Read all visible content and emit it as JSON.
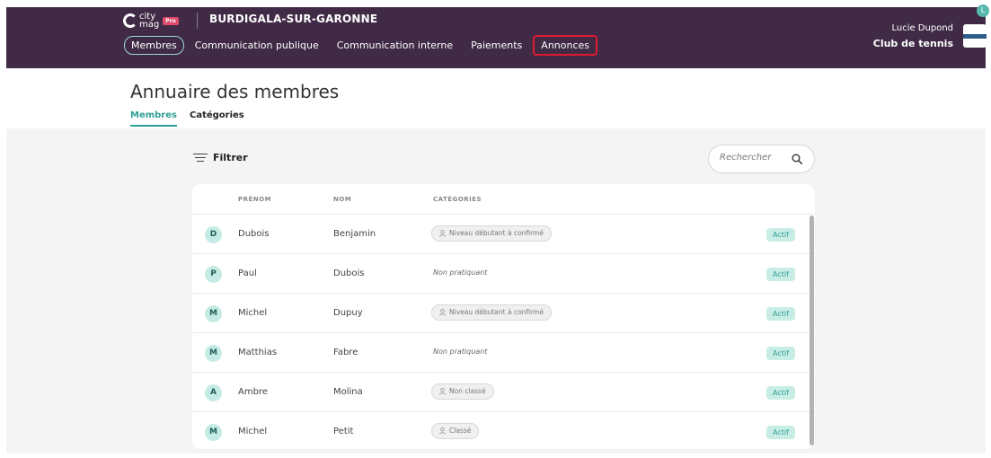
{
  "header": {
    "logo_text_line1": "city",
    "logo_text_line2": "mag",
    "logo_badge": "Pro",
    "org_name": "BURDIGALA-SUR-GARONNE",
    "nav": [
      {
        "label": "Membres"
      },
      {
        "label": "Communication publique"
      },
      {
        "label": "Communication interne"
      },
      {
        "label": "Paiements"
      },
      {
        "label": "Annonces"
      }
    ],
    "user_name": "Lucie Dupond",
    "user_club": "Club de tennis",
    "user_badge": "L"
  },
  "page": {
    "title": "Annuaire des membres",
    "tabs": [
      {
        "label": "Membres"
      },
      {
        "label": "Catégories"
      }
    ]
  },
  "toolbar": {
    "filter_label": "Filtrer",
    "search_placeholder": "Rechercher"
  },
  "table": {
    "headers": {
      "prenom": "PRÉNOM",
      "nom": "NOM",
      "categories": "CATÉGORIES"
    },
    "rows": [
      {
        "initial": "D",
        "prenom": "Dubois",
        "nom": "Benjamin",
        "category": "Niveau débutant à confirmé",
        "status": "Actif"
      },
      {
        "initial": "P",
        "prenom": "Paul",
        "nom": "Dubois",
        "category": "Non pratiquant",
        "status": "Actif"
      },
      {
        "initial": "M",
        "prenom": "Michel",
        "nom": "Dupuy",
        "category": "Niveau débutant à confirmé",
        "status": "Actif"
      },
      {
        "initial": "M",
        "prenom": "Matthias",
        "nom": "Fabre",
        "category": "Non pratiquant",
        "status": "Actif"
      },
      {
        "initial": "A",
        "prenom": "Ambre",
        "nom": "Molina",
        "category": "Non classé",
        "status": "Actif"
      },
      {
        "initial": "M",
        "prenom": "Michel",
        "nom": "Petit",
        "category": "Classé",
        "status": "Actif"
      }
    ]
  },
  "colors": {
    "header_bg": "#402a45",
    "accent": "#2e9f94",
    "highlight_box": "#e0192f"
  }
}
